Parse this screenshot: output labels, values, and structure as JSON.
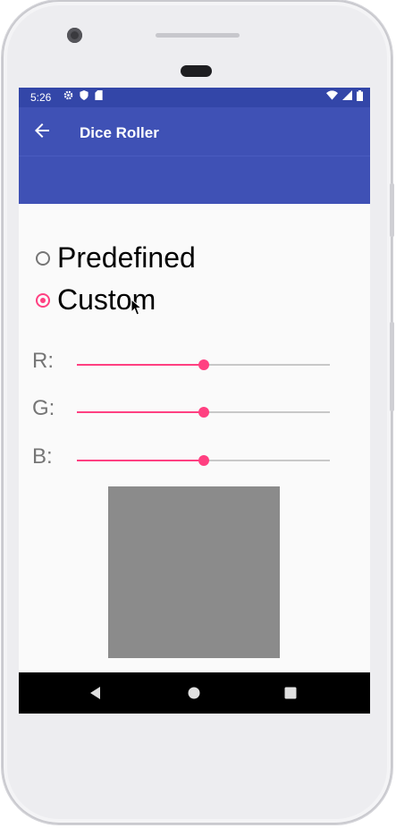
{
  "status_bar": {
    "time": "5:26",
    "icons_left": [
      "gear-icon",
      "shield-icon",
      "sim-card-icon"
    ],
    "icons_right": [
      "wifi-icon",
      "signal-icon",
      "battery-icon"
    ]
  },
  "app_bar": {
    "title": "Dice Roller",
    "back_icon": "arrow-back-icon"
  },
  "radio_group": {
    "options": [
      {
        "label": "Predefined",
        "checked": false
      },
      {
        "label": "Custom",
        "checked": true
      }
    ]
  },
  "sliders": [
    {
      "label": "R:",
      "value_fraction": 0.5
    },
    {
      "label": "G:",
      "value_fraction": 0.5
    },
    {
      "label": "B:",
      "value_fraction": 0.5
    }
  ],
  "color_preview": {
    "color": "#8b8b8b"
  },
  "colors": {
    "primary": "#3f51b5",
    "primary_dark": "#3346a8",
    "accent": "#ff4081"
  },
  "nav_bar": {
    "buttons": [
      "back-triangle-icon",
      "home-circle-icon",
      "recents-square-icon"
    ]
  }
}
